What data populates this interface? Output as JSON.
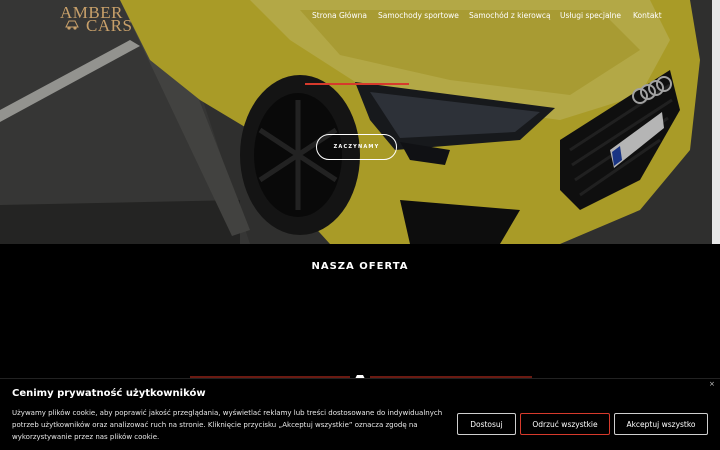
{
  "logo": {
    "line1": "AMBER",
    "line2": "CARS"
  },
  "nav": {
    "items": [
      {
        "label": "Strona Główna"
      },
      {
        "label": "Samochody sportowe"
      },
      {
        "label": "Samochód z kierowcą"
      },
      {
        "label": "Usługi specjalne"
      },
      {
        "label": "Kontakt"
      }
    ]
  },
  "hero": {
    "cta_label": "ZACZYNAMY"
  },
  "offer": {
    "title": "NASZA OFERTA"
  },
  "cookie_banner": {
    "title": "Cenimy prywatność użytkowników",
    "text": "Używamy plików cookie, aby poprawić jakość przeglądania, wyświetlać reklamy lub treści dostosowane do indywidualnych potrzeb użytkowników oraz analizować ruch na stronie. Kliknięcie przycisku „Akceptuj wszystkie” oznacza zgodę na wykorzystywanie przez nas plików cookie.",
    "close_glyph": "×",
    "customize_label": "Dostosuj",
    "reject_label": "Odrzuć wszystkie",
    "accept_label": "Akceptuj wszystko"
  },
  "colors": {
    "accent": "#d63a2c",
    "gold": "#c8a06a",
    "car_yellow": "#e2d13a",
    "background": "#000000"
  }
}
